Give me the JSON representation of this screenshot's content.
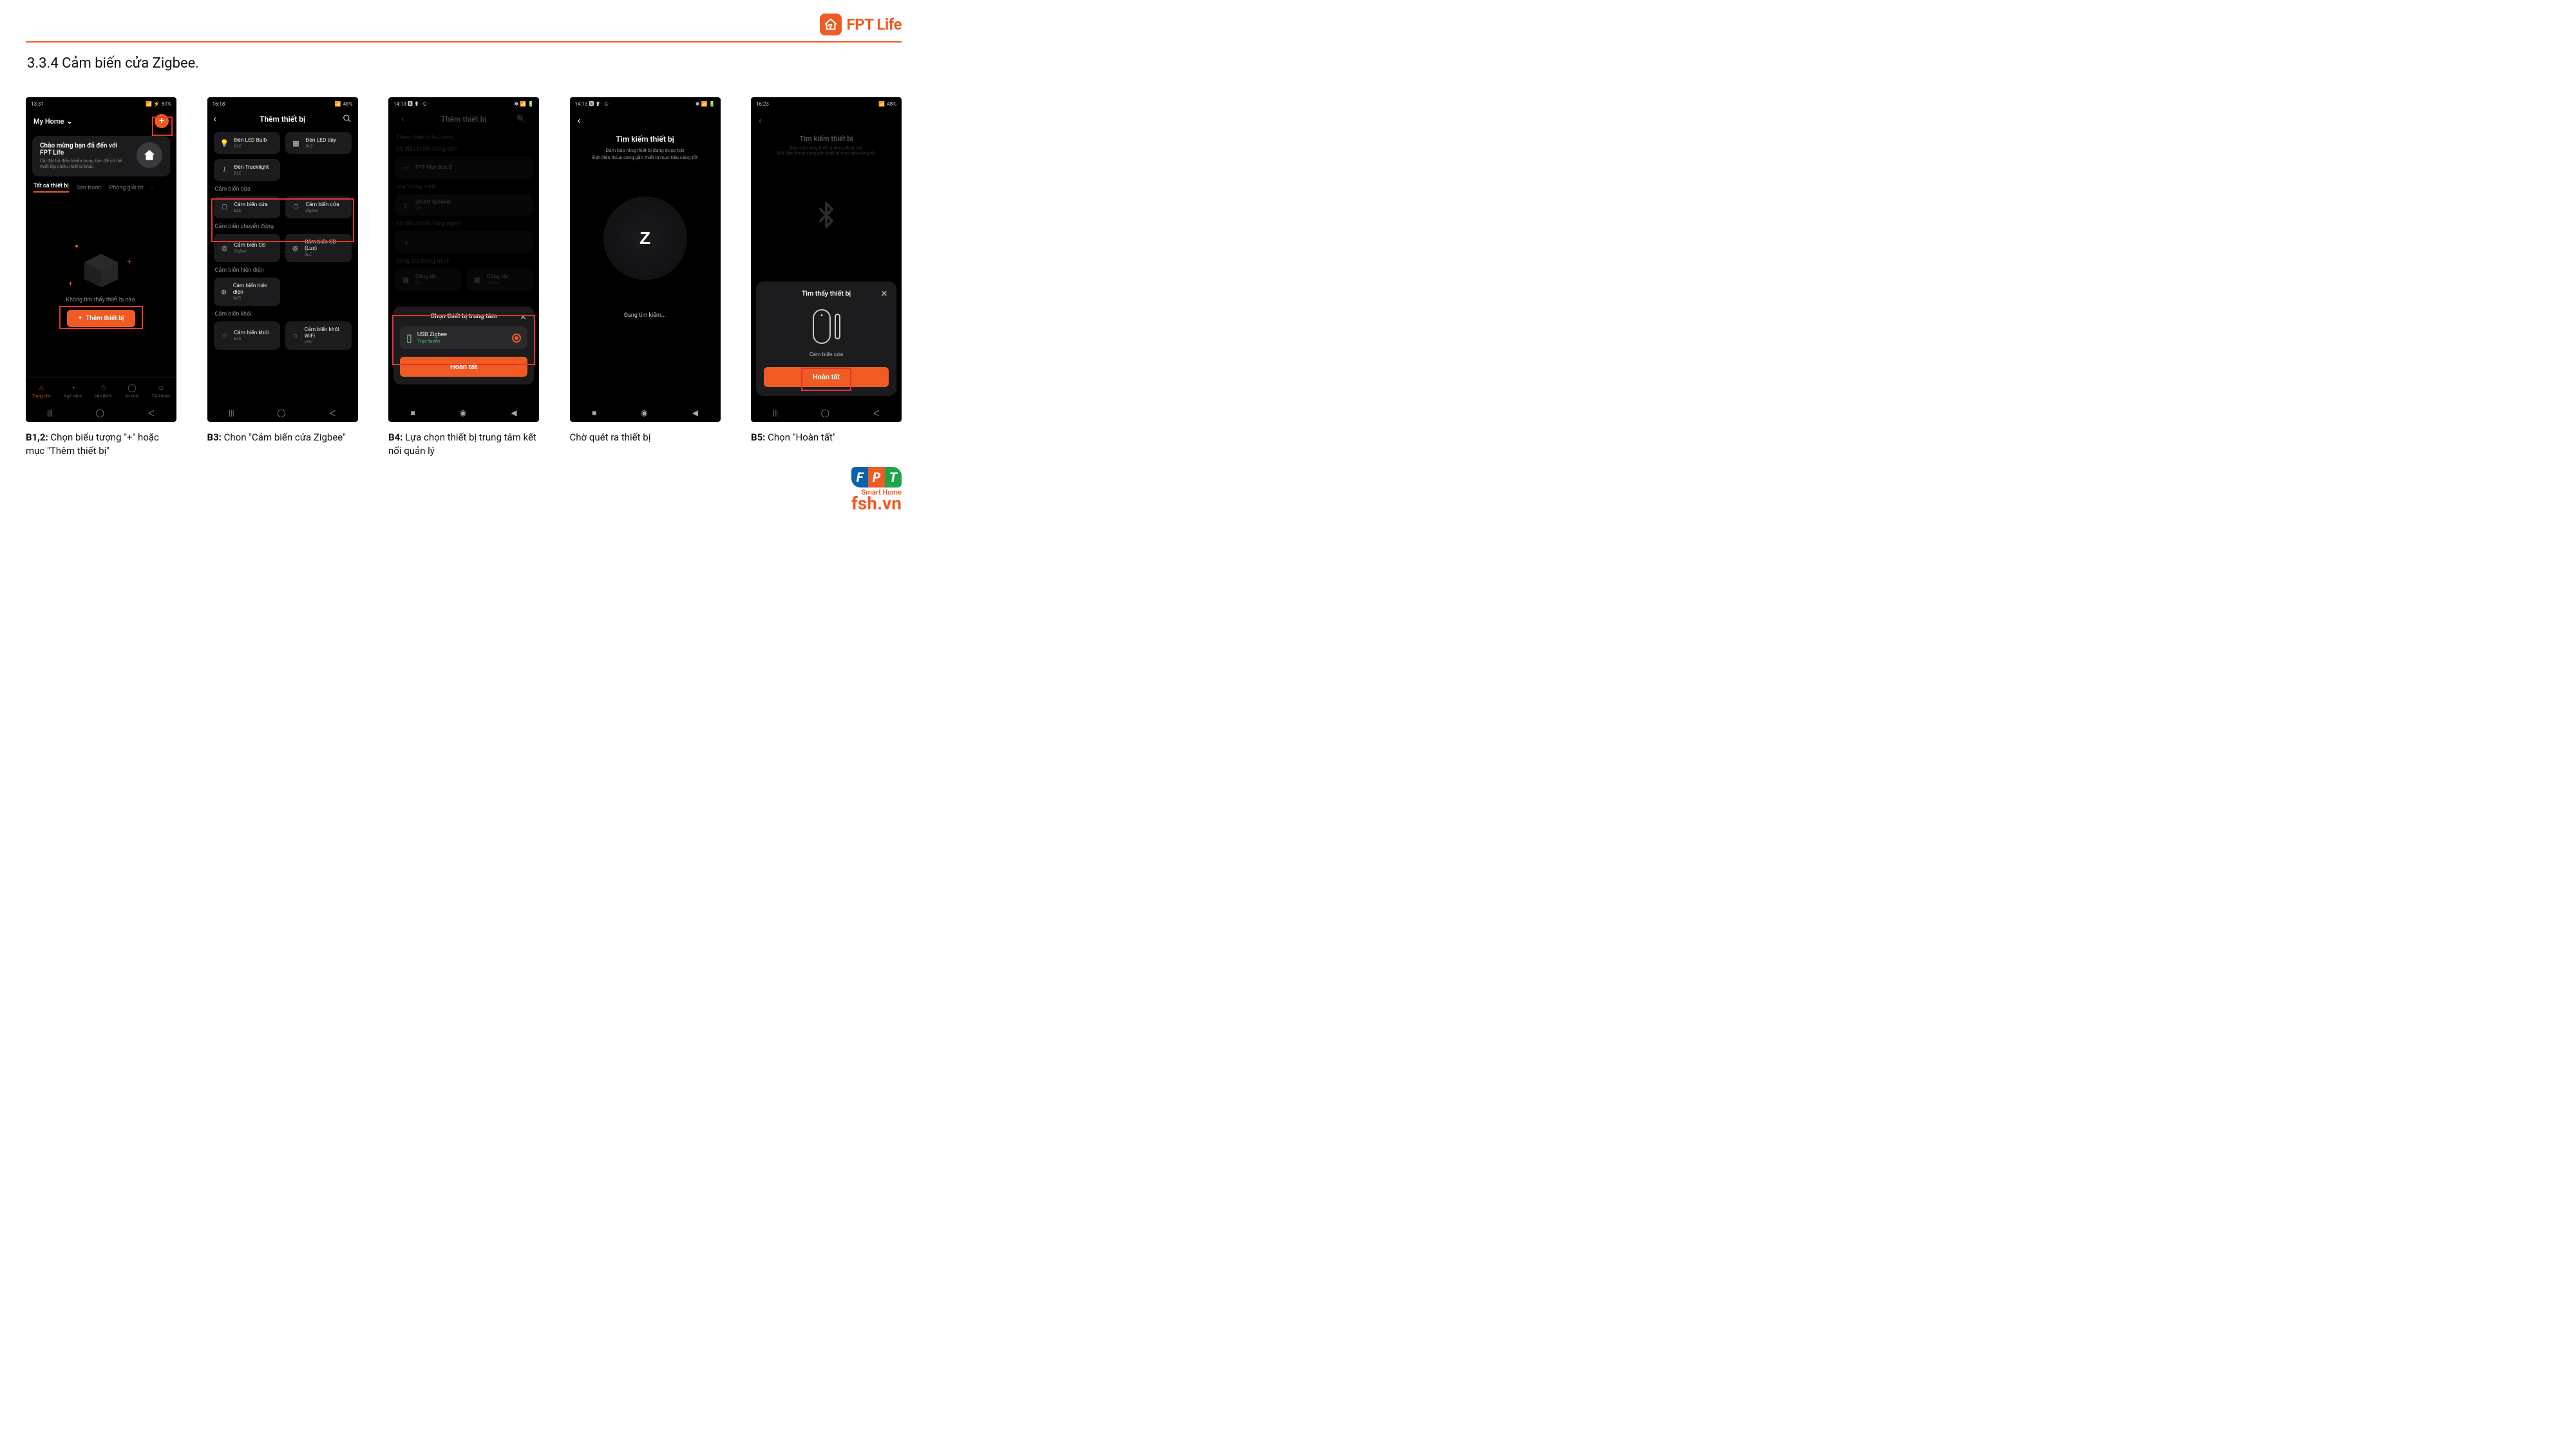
{
  "brand": {
    "header_name": "FPT Life",
    "footer_smarthome": "Smart Home",
    "footer_domain": "fsh.vn"
  },
  "section_title": "3.3.4 Cảm biến cửa Zigbee.",
  "phones": {
    "p1": {
      "status_time": "13:31",
      "status_right": "51%",
      "home_label": "My Home",
      "welcome_title": "Chào mừng bạn đã đến với FPT Life",
      "welcome_sub": "Cài đặt bộ điều khiển trung tâm để có thể thiết lập nhiều thiết bị khác.",
      "tabs": [
        "Tất cả thiết bị",
        "Sân trước",
        "Phòng giải trí",
        "···"
      ],
      "empty_msg": "Không tìm thấy thiết bị nào.",
      "add_button": "Thêm thiết bị",
      "botnav": [
        {
          "label": "Trang chủ",
          "active": true
        },
        {
          "label": "Ngữ cảnh",
          "active": false
        },
        {
          "label": "Yêu thích",
          "active": false
        },
        {
          "label": "An ninh",
          "active": false
        },
        {
          "label": "Tài khoản",
          "active": false
        }
      ]
    },
    "p2": {
      "status_time": "16:18",
      "status_right": "48%",
      "title": "Thêm thiết bị",
      "section_lights": [
        {
          "n": "Đèn LED Bulb",
          "s": "BLE"
        },
        {
          "n": "Đèn LED dây",
          "s": "BLE"
        },
        {
          "n": "Đèn Tracklight",
          "s": "BLE"
        }
      ],
      "cat_door": "Cảm biến cửa",
      "door_tiles": [
        {
          "n": "Cảm biến cửa",
          "s": "BLE"
        },
        {
          "n": "Cảm biến cửa",
          "s": "Zigbee"
        }
      ],
      "cat_motion": "Cảm biến chuyển động",
      "motion_tiles": [
        {
          "n": "Cảm biến CĐ",
          "s": "Zigbee"
        },
        {
          "n": "Cảm biến CĐ (Lux)",
          "s": "BLE"
        }
      ],
      "cat_presence": "Cảm biến hiện diện",
      "presence_tiles": [
        {
          "n": "Cảm biến hiện diện",
          "s": "WiFi"
        }
      ],
      "cat_smoke": "Cảm biến khói",
      "smoke_tiles": [
        {
          "n": "Cảm biến khói",
          "s": "BLE"
        },
        {
          "n": "Cảm biến khói WiFi",
          "s": "WiFi"
        }
      ]
    },
    "p3": {
      "status_time": "14:13",
      "title_dim": "Thêm thiết bị",
      "cat_dim1": "Thêm thiết bị thủ công",
      "sheet_title": "Chọn thiết bị trung tâm",
      "hub_name": "USB Zigbee",
      "hub_status": "Trực tuyến",
      "done": "Hoàn tất"
    },
    "p4": {
      "status_time": "14:13",
      "title": "Tìm kiếm thiết bị",
      "sub1": "Đảm bảo rằng thiết bị đang được bật",
      "sub2": "Đặt điện thoại càng gần thiết bị mục tiêu càng tốt",
      "z": "Z",
      "searching": "Đang tìm kiếm..."
    },
    "p5": {
      "status_time": "16:23",
      "status_right": "48%",
      "title_dim": "Tìm kiếm thiết bị",
      "sub_dim": "Đảm bảo rằng thiết bị đang được bật\nĐặt điện thoại càng gần thiết bị mục tiêu càng tốt",
      "sheet_title": "Tìm thấy thiết bị",
      "device_name": "Cảm biến cửa",
      "done": "Hoàn tất"
    }
  },
  "captions": {
    "c1": {
      "b": "B1,2:",
      "t": " Chọn biểu tượng \"+\" hoặc mục \"Thêm thiết bị\""
    },
    "c2": {
      "b": "B3:",
      "t": " Chon \"Cảm biến cửa Zigbee\""
    },
    "c3": {
      "b": "B4:",
      "t": " Lựa chọn thiết bị trung tâm kết nối quản lý"
    },
    "c4": {
      "b": "",
      "t": "Chờ quét ra thiết bị"
    },
    "c5": {
      "b": "B5:",
      "t": " Chọn \"Hoàn tất\""
    }
  }
}
